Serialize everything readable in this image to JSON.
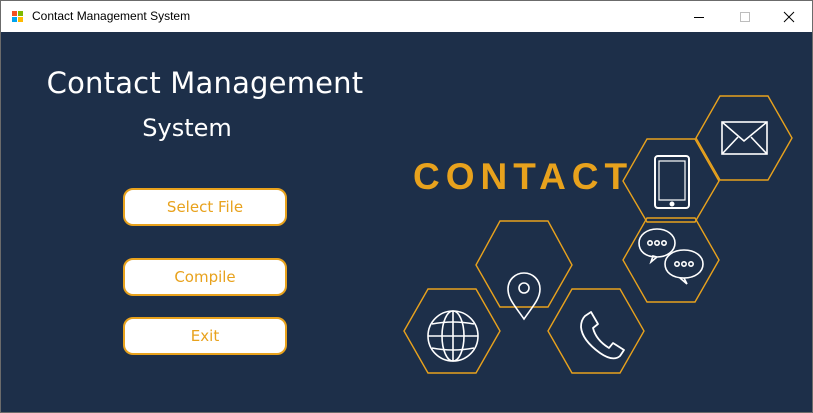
{
  "window": {
    "title": "Contact Management System",
    "icons": {
      "app": "app-icon",
      "minimize": "minimize-icon",
      "maximize": "maximize-icon",
      "close": "close-icon"
    }
  },
  "main": {
    "heading_line1": "Contact Management",
    "heading_line2": "System",
    "buttons": {
      "select_file": "Select File",
      "compile": "Compile",
      "exit": "Exit"
    }
  },
  "graphic": {
    "word": "CONTACT",
    "icons": [
      "globe-icon",
      "location-pin-icon",
      "phone-icon",
      "chat-icon",
      "smartphone-icon",
      "envelope-icon"
    ]
  },
  "colors": {
    "background": "#1d2f49",
    "accent": "#e8a21d",
    "text_light": "#ffffff",
    "titlebar": "#ffffff"
  }
}
